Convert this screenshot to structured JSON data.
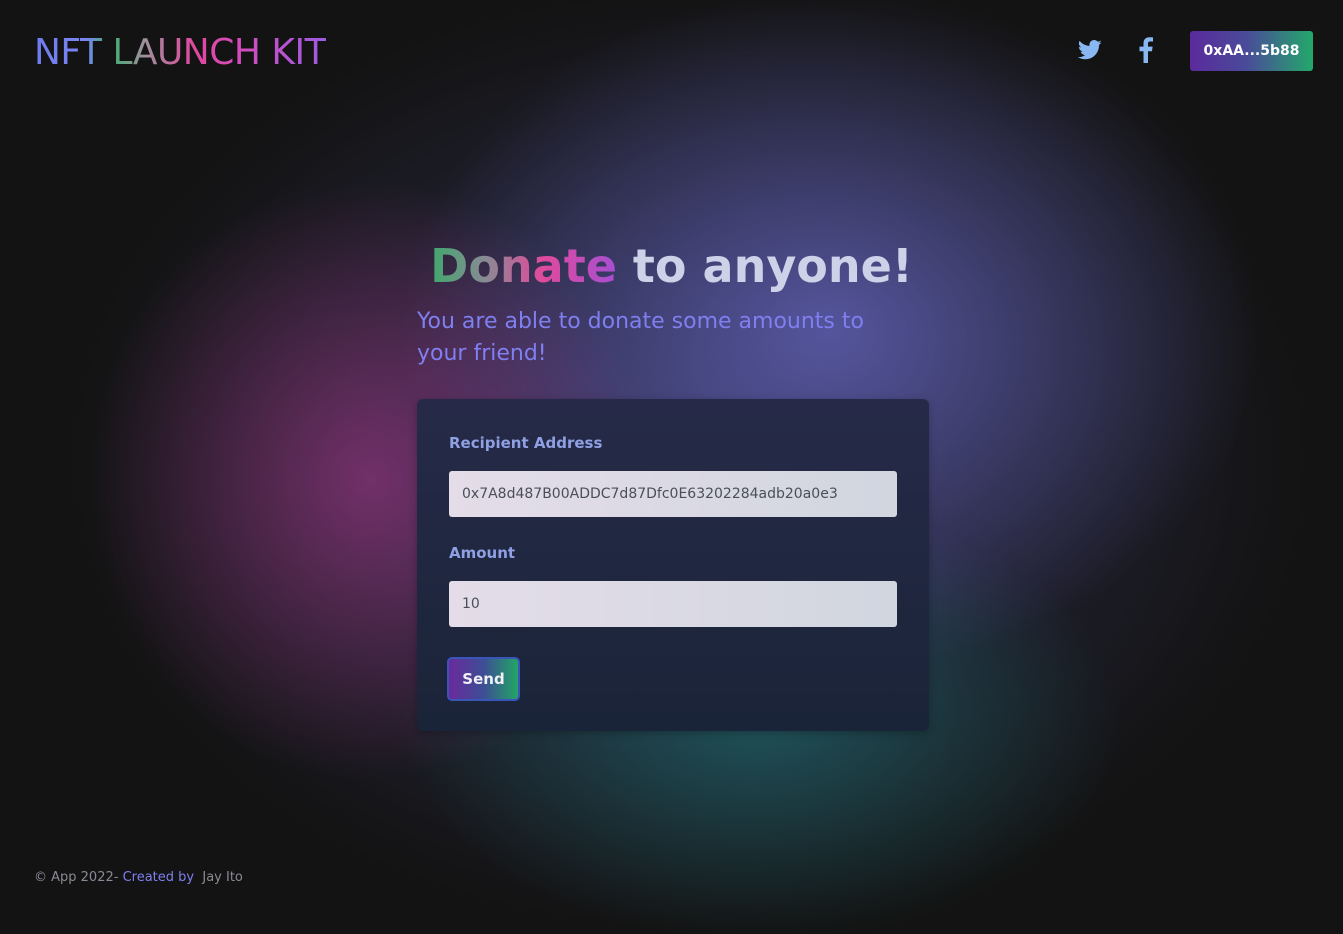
{
  "header": {
    "logo": "NFT LAUNCH KIT",
    "social_icons": [
      "twitter-icon",
      "facebook-icon"
    ],
    "wallet_label": "0xAA...5b88"
  },
  "hero": {
    "title_accent": "Donate",
    "title_rest": " to anyone!",
    "subtitle": "You are able to donate some amounts to your friend!"
  },
  "form": {
    "recipient_label": "Recipient Address",
    "recipient_value": "0x7A8d487B00ADDC7d87Dfc0E63202284adb20a0e3",
    "amount_label": "Amount",
    "amount_value": "10",
    "send_label": "Send"
  },
  "footer": {
    "copyright": "© App 2022-",
    "created_by_label": "Created by",
    "author": "Jay Ito"
  },
  "colors": {
    "background": "#131313",
    "accent_purple": "#7f7ff0",
    "label_blue": "#8fa0e4",
    "card": "#232740",
    "icon_blue": "#89b7f2"
  }
}
